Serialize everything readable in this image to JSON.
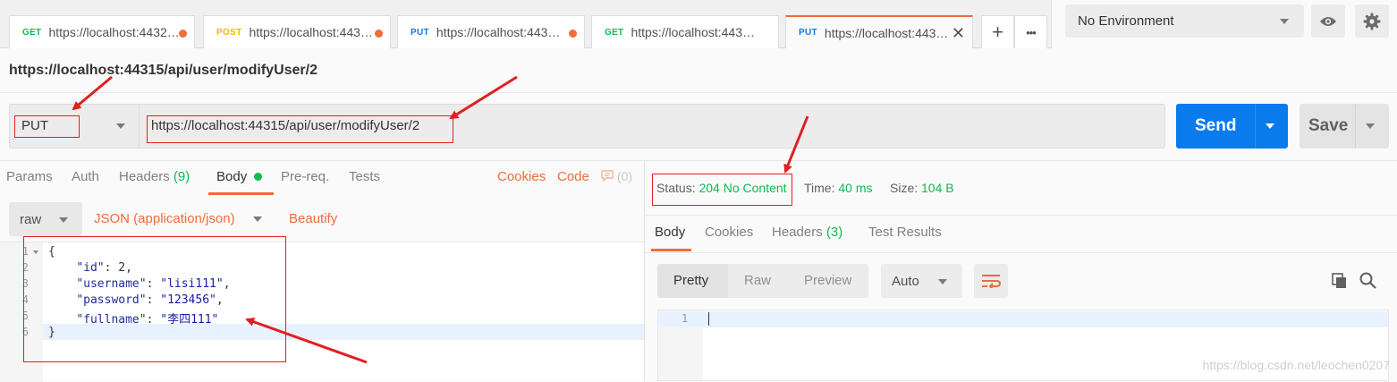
{
  "tabs": [
    {
      "method": "GET",
      "url": "https://localhost:4432…",
      "modified": true
    },
    {
      "method": "POST",
      "url": "https://localhost:443…",
      "modified": true
    },
    {
      "method": "PUT",
      "url": "https://localhost:443…",
      "modified": true
    },
    {
      "method": "GET",
      "url": "https://localhost:443…",
      "modified": false
    },
    {
      "method": "PUT",
      "url": "https://localhost:443…",
      "active": true
    }
  ],
  "tab_controls": {
    "add": "+",
    "more": "•••"
  },
  "environment": {
    "selected": "No Environment"
  },
  "request": {
    "title": "https://localhost:44315/api/user/modifyUser/2",
    "method": "PUT",
    "url": "https://localhost:44315/api/user/modifyUser/2",
    "send_label": "Send",
    "save_label": "Save"
  },
  "request_tabs": {
    "params": "Params",
    "auth": "Auth",
    "headers": "Headers",
    "headers_count": "(9)",
    "body": "Body",
    "prereq": "Pre-req.",
    "tests": "Tests",
    "cookies": "Cookies",
    "code": "Code",
    "comments_count": "(0)"
  },
  "body_options": {
    "mode": "raw",
    "content_type": "JSON (application/json)",
    "beautify": "Beautify"
  },
  "editor": {
    "line_numbers": [
      "1",
      "2",
      "3",
      "4",
      "5",
      "6"
    ],
    "lines": [
      [
        "{"
      ],
      [
        "    ",
        "\"id\"",
        ": 2,"
      ],
      [
        "    ",
        "\"username\"",
        ": ",
        "\"lisi111\"",
        ","
      ],
      [
        "    ",
        "\"password\"",
        ": ",
        "\"123456\"",
        ","
      ],
      [
        "    ",
        "\"fullname\"",
        ": ",
        "\"李四111\""
      ],
      [
        "}"
      ]
    ]
  },
  "response_status": {
    "status_label": "Status:",
    "status_value": "204 No Content",
    "time_label": "Time:",
    "time_value": "40 ms",
    "size_label": "Size:",
    "size_value": "104 B"
  },
  "response_tabs": {
    "body": "Body",
    "cookies": "Cookies",
    "headers": "Headers",
    "headers_count": "(3)",
    "test_results": "Test Results"
  },
  "response_view": {
    "pretty": "Pretty",
    "raw": "Raw",
    "preview": "Preview",
    "format": "Auto",
    "line_number": "1"
  },
  "watermark": "https://blog.csdn.net/leochen0207",
  "colors": {
    "accent": "#f26b3a",
    "send": "#097bed",
    "get": "#0cbb52",
    "post": "#ffb400",
    "put": "#097bed",
    "annotation": "#e02020"
  }
}
